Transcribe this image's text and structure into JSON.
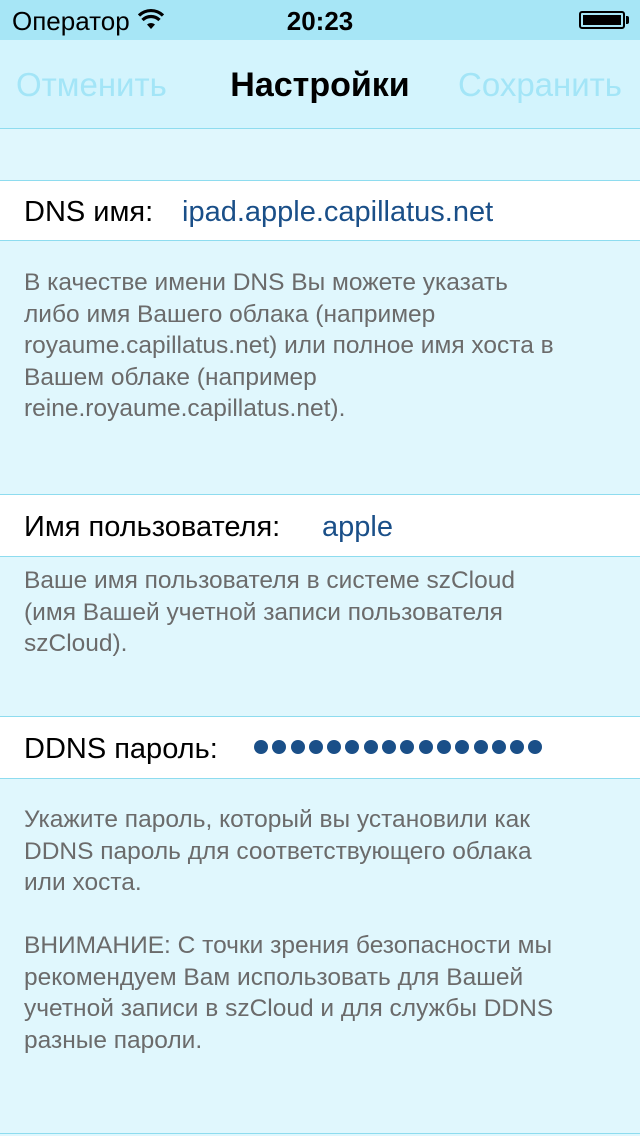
{
  "status_bar": {
    "carrier": "Оператор",
    "time": "20:23",
    "wifi_icon": "wifi-icon",
    "battery_icon": "battery-icon"
  },
  "nav": {
    "cancel": "Отменить",
    "title": "Настройки",
    "save": "Сохранить"
  },
  "fields": {
    "dns": {
      "label": "DNS имя:",
      "value": "ipad.apple.capillatus.net",
      "footer": [
        "В качестве имени DNS Вы можете указать",
        "либо имя Вашего облака (например",
        "royaume.capillatus.net) или полное имя хоста в",
        "Вашем облаке (например",
        "reine.royaume.capillatus.net)."
      ]
    },
    "username": {
      "label": "Имя пользователя:",
      "value": "apple",
      "footer": [
        "Ваше имя пользователя в системе szCloud",
        "(имя Вашей учетной записи пользователя",
        "szCloud)."
      ]
    },
    "password": {
      "label": "DDNS пароль:",
      "masked_length": 16,
      "footer": [
        "Укажите пароль, который вы установили как",
        "DDNS пароль для соответствующего облака",
        "или хоста.",
        "",
        "ВНИМАНИЕ: С точки зрения безопасности мы",
        "рекомендуем Вам использовать для Вашей",
        "учетной записи в szCloud и для службы DDNS",
        "разные пароли."
      ]
    }
  },
  "colors": {
    "background": "#e0f7fd",
    "status_bar": "#a7e6f6",
    "nav_button": "#a3e5f7",
    "value_text": "#1a4f88",
    "footer_text": "#6b6b6b",
    "separator": "#8edcef"
  }
}
